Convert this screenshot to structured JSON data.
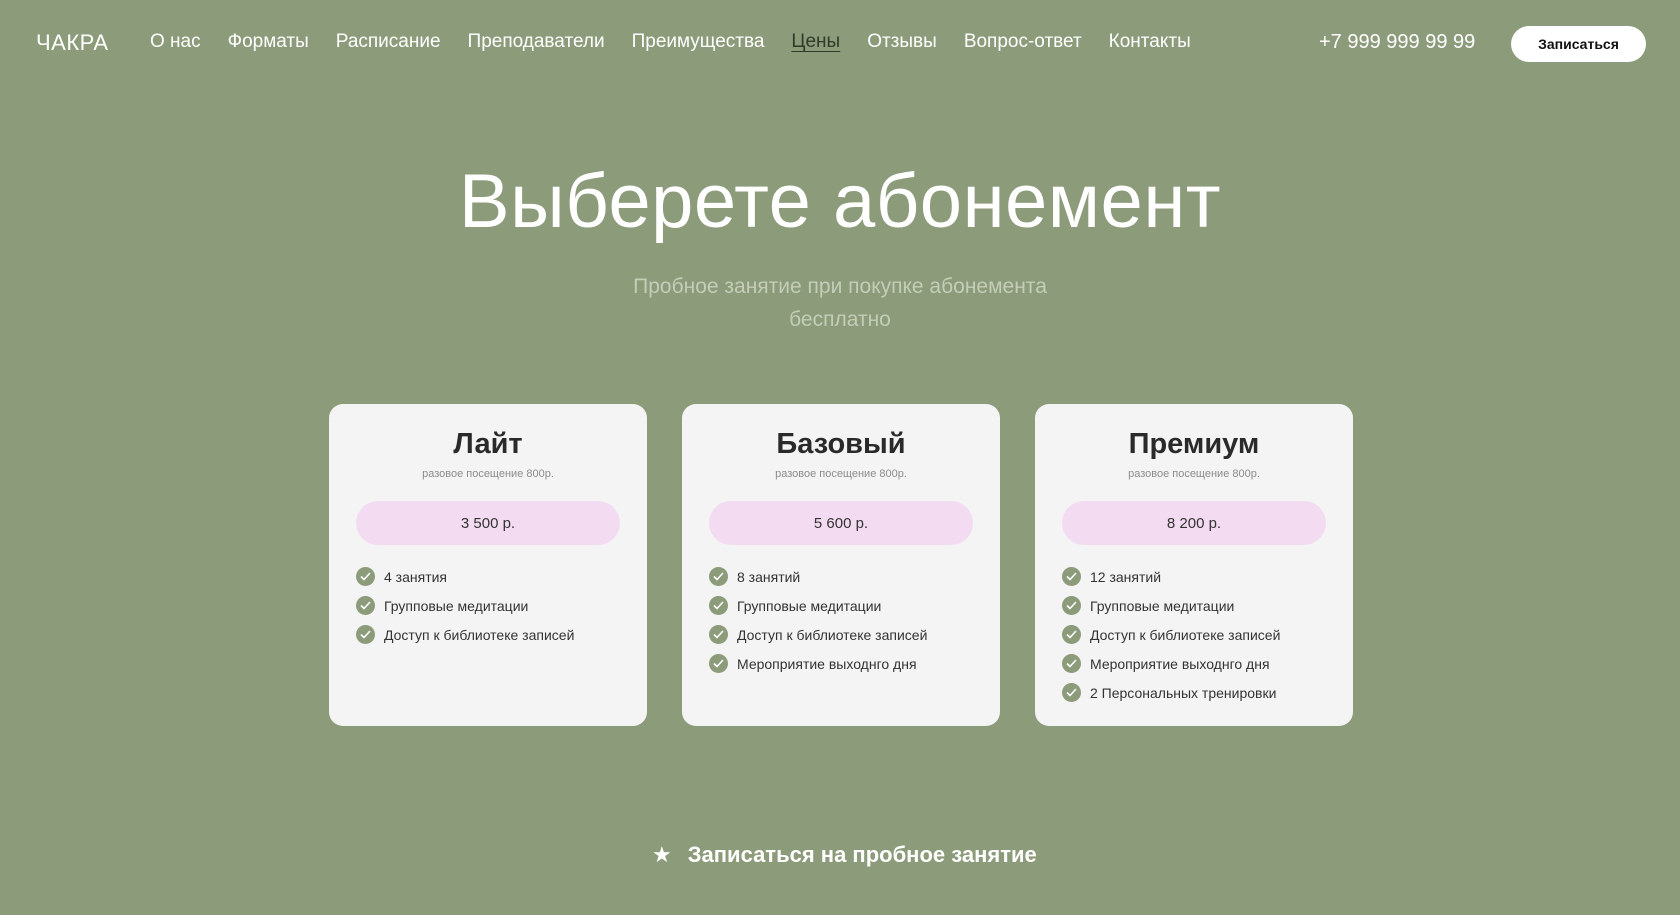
{
  "header": {
    "logo": "ЧАКРА",
    "nav": [
      {
        "label": "О нас",
        "active": false
      },
      {
        "label": "Форматы",
        "active": false
      },
      {
        "label": "Расписание",
        "active": false
      },
      {
        "label": "Преподаватели",
        "active": false
      },
      {
        "label": "Преимущества",
        "active": false
      },
      {
        "label": "Цены",
        "active": true
      },
      {
        "label": "Отзывы",
        "active": false
      },
      {
        "label": "Вопрос-ответ",
        "active": false
      },
      {
        "label": "Контакты",
        "active": false
      }
    ],
    "phone": "+7 999 999 99 99",
    "signup_label": "Записаться"
  },
  "hero": {
    "title": "Выберете абонемент",
    "subtitle": "Пробное занятие при покупке абонемента бесплатно"
  },
  "plans": [
    {
      "title": "Лайт",
      "note": "разовое посещение 800р.",
      "price": "3 500 р.",
      "features": [
        "4 занятия",
        "Групповые медитации",
        "Доступ к библиотеке записей"
      ]
    },
    {
      "title": "Базовый",
      "note": "разовое посещение 800р.",
      "price": "5 600 р.",
      "features": [
        "8 занятий",
        "Групповые медитации",
        "Доступ к библиотеке записей",
        "Мероприятие выходнго дня"
      ]
    },
    {
      "title": "Премиум",
      "note": "разовое посещение 800р.",
      "price": "8 200 р.",
      "features": [
        "12 занятий",
        "Групповые медитации",
        "Доступ к библиотеке записей",
        "Мероприятие выходнго дня",
        "2 Персональных тренировки"
      ]
    }
  ],
  "cta": {
    "icon": "star-icon",
    "label": "Записаться на пробное занятие"
  },
  "colors": {
    "background": "#8c9b7a",
    "card": "#f4f4f4",
    "price_pill": "#f3dcf1",
    "check": "#8c9b7a"
  }
}
